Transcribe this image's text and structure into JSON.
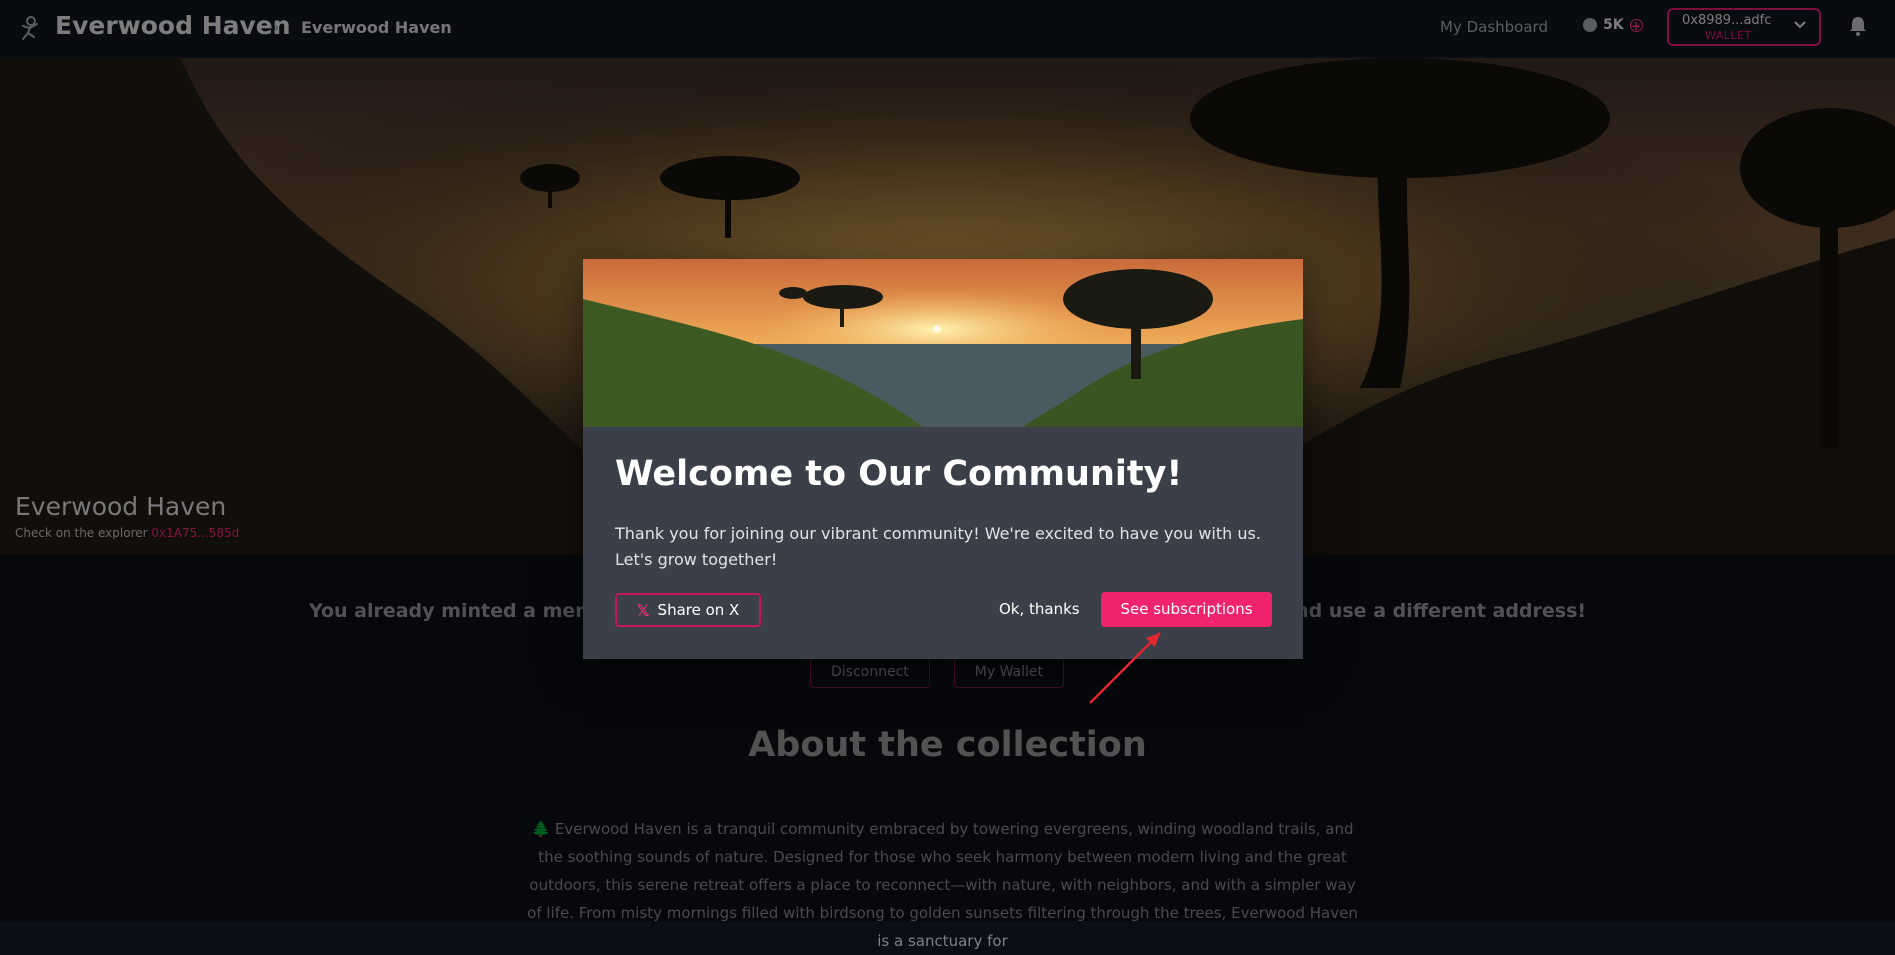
{
  "header": {
    "app_title": "Everwood Haven",
    "breadcrumb": "Everwood Haven",
    "dashboard_link": "My Dashboard",
    "credits": "5K",
    "wallet_address": "0x8989...adfc",
    "wallet_label": "WALLET"
  },
  "hero": {
    "title": "Everwood Haven",
    "explorer_text": "Check on the explorer",
    "explorer_address": "0x1A75...585d"
  },
  "main": {
    "notice_left": "You already minted a mem",
    "notice_right": "nd use a different address!",
    "disconnect_label": "Disconnect",
    "my_wallet_label": "My Wallet",
    "about_title": "About the collection",
    "about_text": "🌲 Everwood Haven is a tranquil community embraced by towering evergreens, winding woodland trails, and the soothing sounds of nature. Designed for those who seek harmony between modern living and the great outdoors, this serene retreat offers a place to reconnect—with nature, with neighbors, and with a simpler way of life. From misty mornings filled with birdsong to golden sunsets filtering through the trees, Everwood Haven is a sanctuary for"
  },
  "modal": {
    "title": "Welcome to Our Community!",
    "body": "Thank you for joining our vibrant community! We're excited to have you with us. Let's grow together!",
    "share_label": "Share on X",
    "ok_label": "Ok, thanks",
    "subscriptions_label": "See subscriptions"
  },
  "colors": {
    "accent": "#f0246e",
    "accent_border": "#d7196a",
    "topbar_bg": "#0f131a",
    "modal_bg": "#3a3f49"
  },
  "icons": [
    "astronaut-logo-icon",
    "chevron-right-icon",
    "coin-icon",
    "plus-circle-icon",
    "chevron-down-icon",
    "bell-icon",
    "x-logo-icon",
    "tree-emoji-icon"
  ]
}
